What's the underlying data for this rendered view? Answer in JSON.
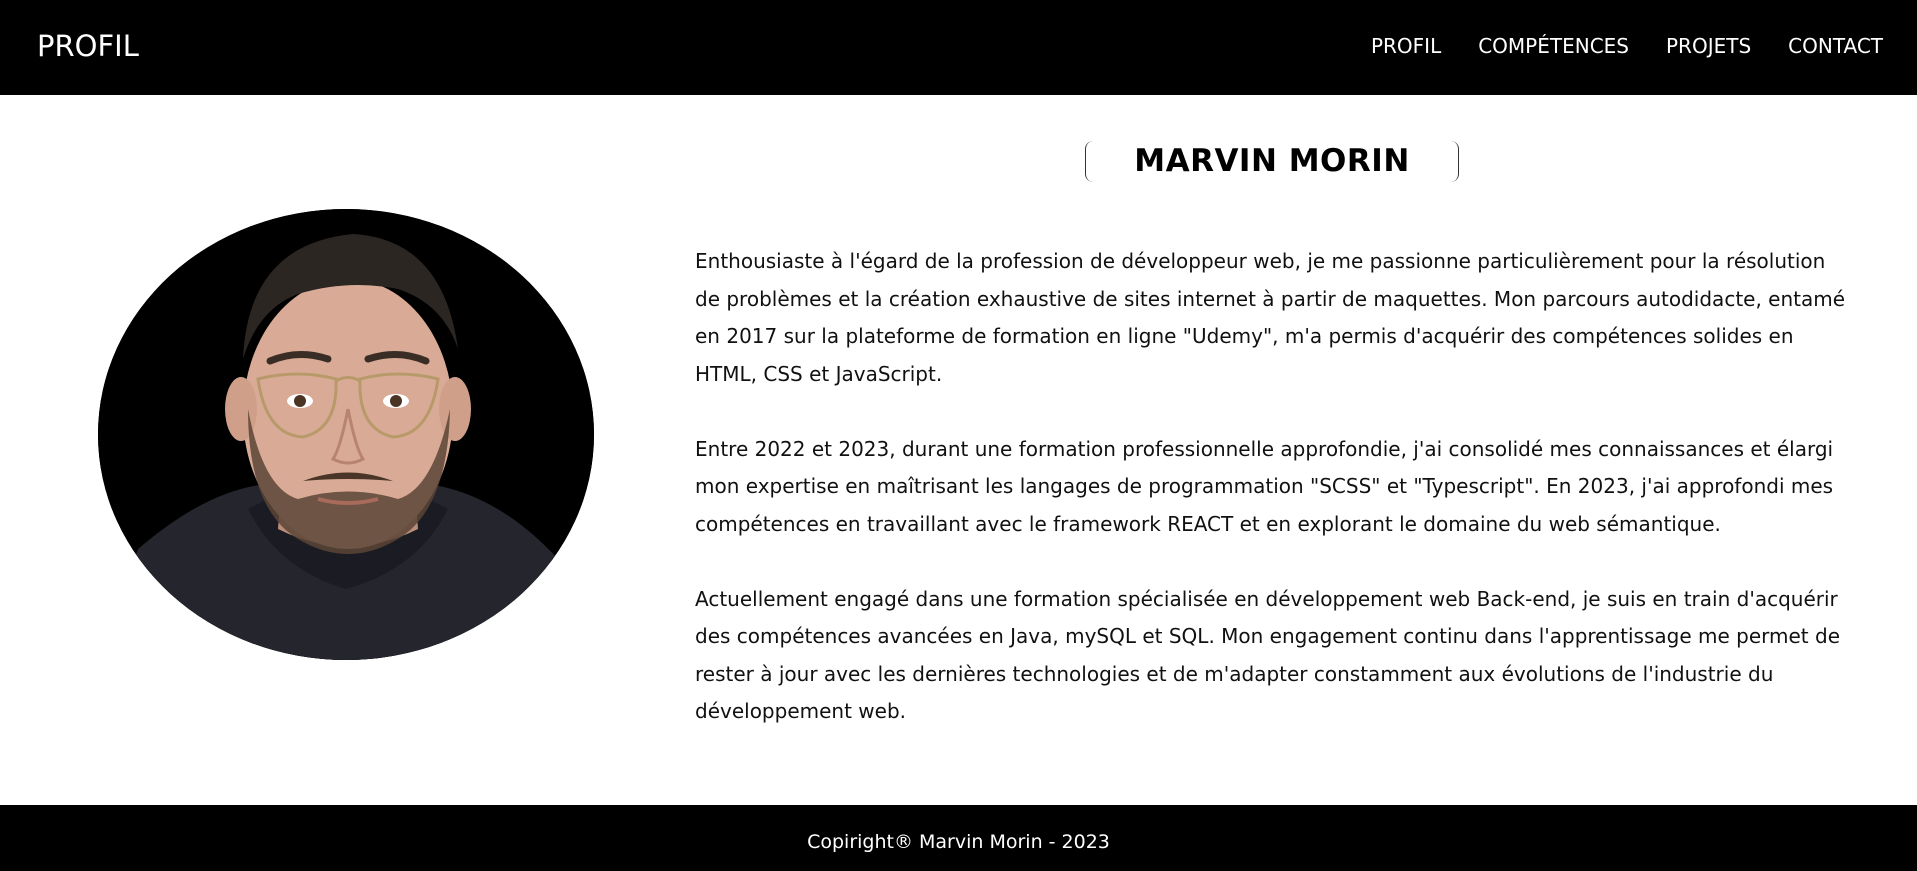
{
  "header": {
    "brand": "PROFIL",
    "nav": [
      {
        "label": "PROFIL"
      },
      {
        "label": "COMPÉTENCES"
      },
      {
        "label": "PROJETS"
      },
      {
        "label": "CONTACT"
      }
    ]
  },
  "main": {
    "title": "MARVIN MORIN",
    "photo_alt": "Marvin Morin",
    "paragraphs": [
      "Enthousiaste à l'égard de la profession de développeur web, je me passionne particulièrement pour la résolution de problèmes et la création exhaustive de sites internet à partir de maquettes. Mon parcours autodidacte, entamé en 2017 sur la plateforme de formation en ligne \"Udemy\", m'a permis d'acquérir des compétences solides en HTML, CSS et JavaScript.",
      "Entre 2022 et 2023, durant une formation professionnelle approfondie, j'ai consolidé mes connaissances et élargi mon expertise en maîtrisant les langages de programmation \"SCSS\" et \"Typescript\". En 2023, j'ai approfondi mes compétences en travaillant avec le framework REACT et en explorant le domaine du web sémantique.",
      "Actuellement engagé dans une formation spécialisée en développement web Back-end, je suis en train d'acquérir des compétences avancées en Java, mySQL et SQL. Mon engagement continu dans l'apprentissage me permet de rester à jour avec les dernières technologies et de m'adapter constamment aux évolutions de l'industrie du développement web."
    ]
  },
  "footer": {
    "copyright": "Copiright® Marvin Morin - 2023"
  },
  "colors": {
    "bar_background": "#000000",
    "bar_text": "#ffffff",
    "page_background": "#ffffff",
    "body_text": "#111111"
  }
}
